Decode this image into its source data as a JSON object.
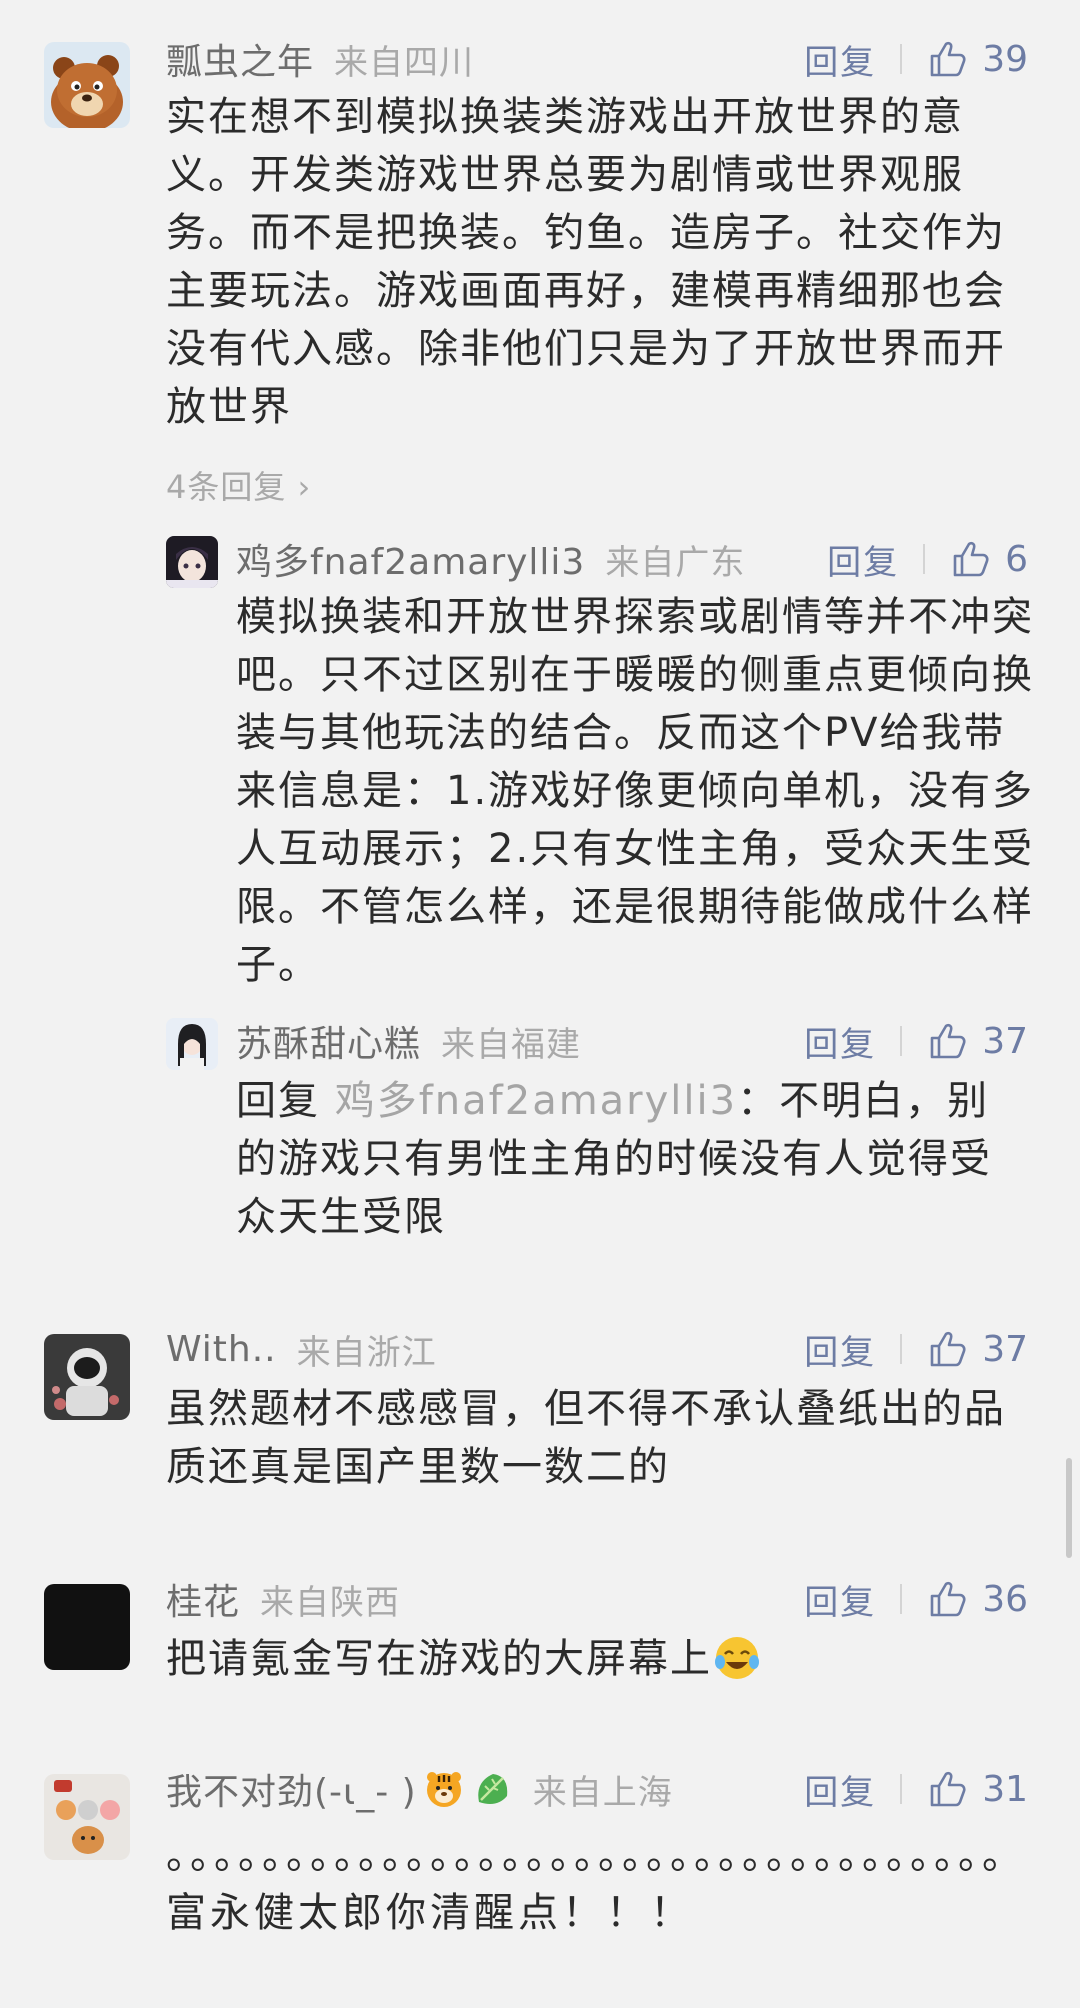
{
  "comments": [
    {
      "username": "瓢虫之年",
      "location": "来自四川",
      "reply_label": "回复",
      "likes": "39",
      "text": "实在想不到模拟换装类游戏出开放世界的意义。开发类游戏世界总要为剧情或世界观服务。而不是把换装。钓鱼。造房子。社交作为主要玩法。游戏画面再好，建模再精细那也会没有代入感。除非他们只是为了开放世界而开放世界",
      "more_replies": "4条回复",
      "avatar_icon": "bear-cartoon-avatar",
      "replies": [
        {
          "username": "鸡多fnaf2amarylli3",
          "location": "来自广东",
          "reply_label": "回复",
          "likes": "6",
          "text": "模拟换装和开放世界探索或剧情等并不冲突吧。只不过区别在于暖暖的侧重点更倾向换装与其他玩法的结合。反而这个PV给我带来信息是：1.游戏好像更倾向单机，没有多人互动展示；2.只有女性主角，受众天生受限。不管怎么样，还是很期待能做成什么样子。",
          "avatar_icon": "anime-character-avatar"
        },
        {
          "username": "苏酥甜心糕",
          "location": "来自福建",
          "reply_label": "回复",
          "likes": "37",
          "reply_prefix": "回复 ",
          "reply_to": "鸡多fnaf2amarylli3",
          "text": "：不明白，别的游戏只有男性主角的时候没有人觉得受众天生受限",
          "avatar_icon": "girl-photo-avatar"
        }
      ]
    },
    {
      "username": "With..",
      "location": "来自浙江",
      "reply_label": "回复",
      "likes": "37",
      "text": "虽然题材不感感冒，但不得不承认叠纸出的品质还真是国产里数一数二的",
      "avatar_icon": "astronaut-avatar"
    },
    {
      "username": "桂花",
      "location": "来自陕西",
      "reply_label": "回复",
      "likes": "36",
      "text": "把请氪金写在游戏的大屏幕上",
      "avatar_icon": "black-avatar",
      "emoji": "crying-laughing-emoji"
    },
    {
      "username": "我不对劲(-ι_- )",
      "location": "来自上海",
      "reply_label": "回复",
      "likes": "31",
      "text": "。。。。。。。。。。。。。。。。。。。。。。。。。。。。。。。。。。。富永健太郎你清醒点！！！",
      "avatar_icon": "shiba-dogs-avatar",
      "name_emojis": [
        "tiger-emoji",
        "lettuce-emoji"
      ]
    }
  ],
  "colors": {
    "background": "#f2f2f2",
    "text": "#2b2b2b",
    "meta": "#a9a9a9",
    "accent": "#6d7ca4"
  }
}
